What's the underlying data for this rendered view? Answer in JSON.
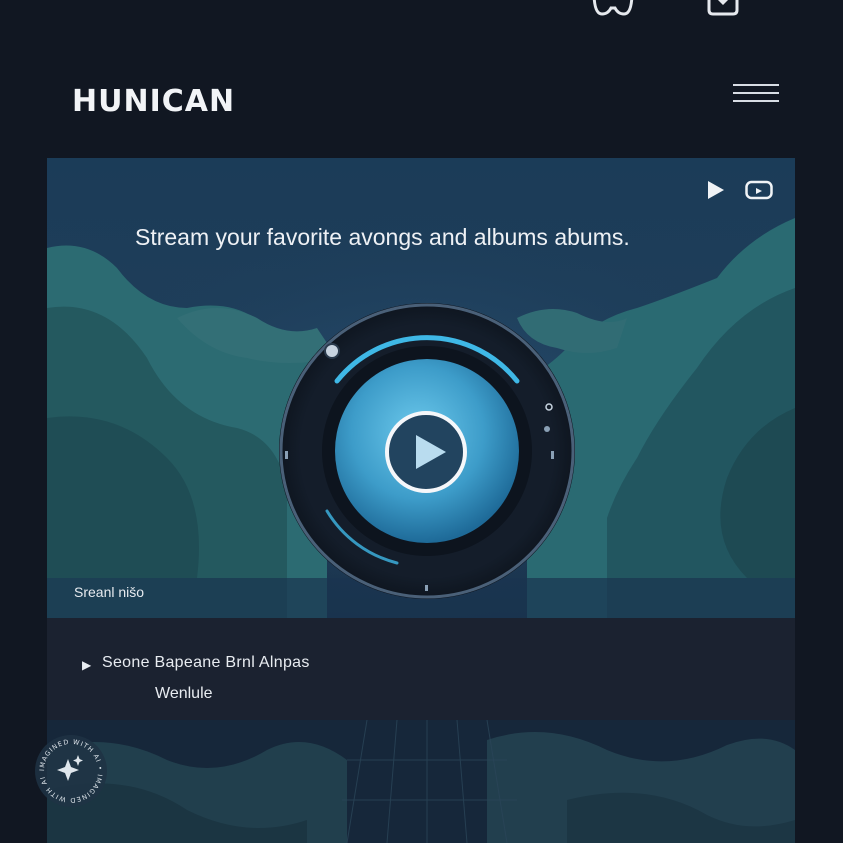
{
  "header": {
    "brand": "HUNICAN",
    "icons": [
      "controller-icon",
      "heart-badge-icon"
    ],
    "menu_icon": "hamburger-menu-icon"
  },
  "hero": {
    "title": "Stream your favorite avongs and albums abums.",
    "caption": "Sreanl nišo",
    "controls": [
      "play-icon",
      "youtube-icon"
    ],
    "accent_color": "#3fb8e6"
  },
  "track": {
    "title": "Seone  Bapeane  Brnl  Alnpas",
    "subtitle": "Wenlule"
  },
  "watermark": {
    "text": "IMAGINED WITH AI • IMAGINED WITH AI •"
  }
}
